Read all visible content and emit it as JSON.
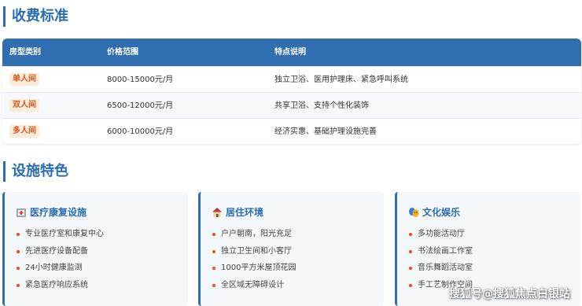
{
  "fees": {
    "title": "收费标准",
    "headers": [
      "房型类别",
      "价格范围",
      "特点说明"
    ],
    "rows": [
      {
        "type": "单人间",
        "price": "8000-15000元/月",
        "desc": "独立卫浴、医用护理床、紧急呼叫系统"
      },
      {
        "type": "双人间",
        "price": "6500-12000元/月",
        "desc": "共享卫浴、支持个性化装饰"
      },
      {
        "type": "多人间",
        "price": "6000-10000元/月",
        "desc": "经济实惠、基础护理设施完善"
      }
    ]
  },
  "facilities": {
    "title": "设施特色",
    "cards": [
      {
        "icon": "hospital-icon",
        "title": "医疗康复设施",
        "items": [
          "专业医疗室和康复中心",
          "先进医疗设备配备",
          "24小时健康监测",
          "紧急医疗响应系统"
        ]
      },
      {
        "icon": "house-icon",
        "title": "居住环境",
        "items": [
          "户户朝南，阳光充足",
          "独立卫生间和小客厅",
          "1000平方米屋顶花园",
          "全区域无障碍设计"
        ]
      },
      {
        "icon": "theater-masks-icon",
        "title": "文化娱乐",
        "items": [
          "多功能活动厅",
          "书法绘画工作室",
          "音乐舞蹈活动室",
          "手工艺制作空间"
        ]
      }
    ]
  },
  "watermark": "搜狐号@搜狐焦点白银站",
  "colors": {
    "accent": "#2f6fb0",
    "badge_bg": "#fdebd8",
    "badge_text": "#d9531e"
  }
}
